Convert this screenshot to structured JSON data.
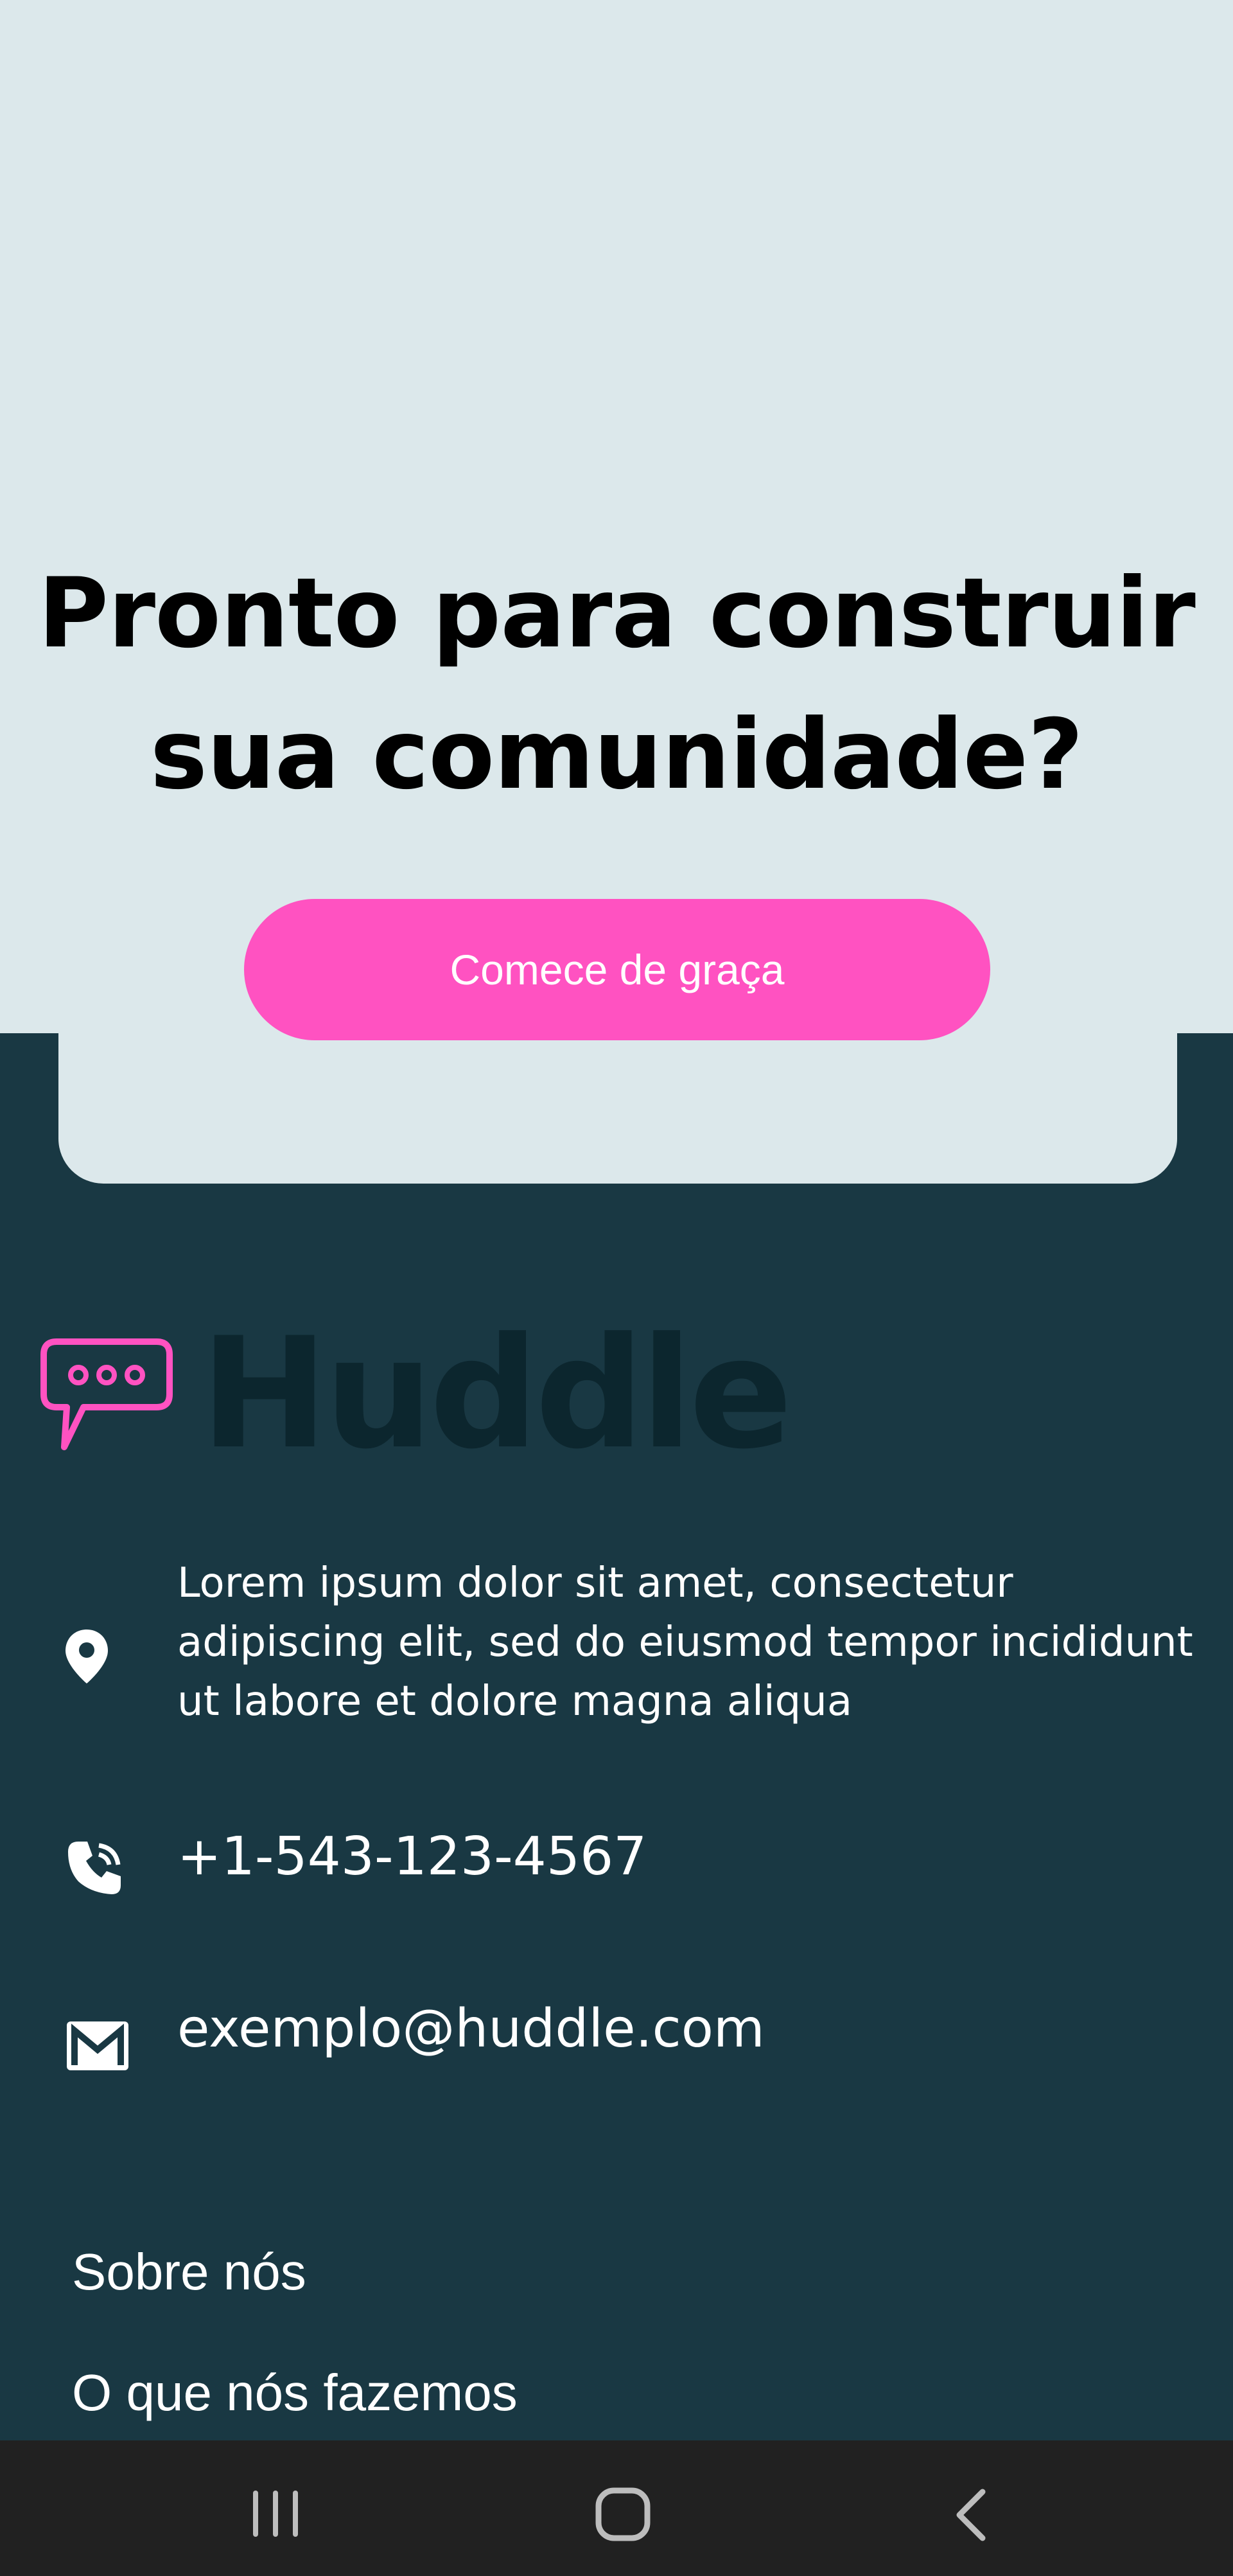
{
  "cta": {
    "headline_line1": "Pronto para construir",
    "headline_line2": "sua comunidade?",
    "button_label": "Comece de graça"
  },
  "footer": {
    "brand": "Huddle",
    "address": "Lorem ipsum dolor sit amet, consectetur adipiscing elit, sed do eiusmod tempor incididunt ut labore et dolore magna aliqua",
    "phone": "+1-543-123-4567",
    "email": "exemplo@huddle.com",
    "links": [
      "Sobre nós",
      "O que nós fazemos"
    ]
  },
  "system_nav": {
    "icons": [
      "recent-apps-icon",
      "home-icon",
      "back-icon"
    ]
  },
  "colors": {
    "accent": "#ff52c1",
    "footer_bg": "#193843",
    "light_bg": "#dce8eb",
    "logo_text": "#0c262e",
    "navbar_bg": "#212121"
  }
}
